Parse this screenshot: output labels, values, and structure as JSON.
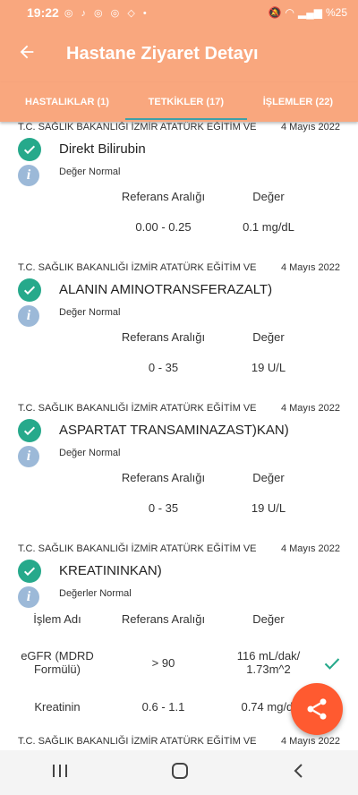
{
  "status_bar": {
    "time": "19:22",
    "battery": "%25"
  },
  "app_bar": {
    "title": "Hastane Ziyaret Detayı"
  },
  "tabs": [
    {
      "label": "HASTALIKLAR (1)"
    },
    {
      "label": "TETKİKLER (17)"
    },
    {
      "label": "İŞLEMLER (22)"
    }
  ],
  "colors": {
    "header": "#f9a77e",
    "check": "#26a98b",
    "info": "#9cb9d8",
    "fab": "#ff5a30",
    "tab_indicator": "#3fa0a8"
  },
  "labels": {
    "ref_range": "Referans Aralığı",
    "value": "Değer",
    "process_name": "İşlem Adı"
  },
  "tests": [
    {
      "hospital": "T.C. SAĞLIK BAKANLIĞI İZMİR ATATÜRK EĞİTİM VE",
      "date": "4 Mayıs 2022",
      "name": "Direkt Bilirubin",
      "status": "Değer Normal",
      "range": "0.00 - 0.25",
      "value": "0.1 mg/dL"
    },
    {
      "hospital": "T.C. SAĞLIK BAKANLIĞI İZMİR ATATÜRK EĞİTİM VE",
      "date": "4 Mayıs 2022",
      "name": "ALANIN AMINOTRANSFERAZALT)",
      "status": "Değer Normal",
      "range": "0 - 35",
      "value": "19 U/L"
    },
    {
      "hospital": "T.C. SAĞLIK BAKANLIĞI İZMİR ATATÜRK EĞİTİM VE",
      "date": "4 Mayıs 2022",
      "name": "ASPARTAT TRANSAMINAZAST)KAN)",
      "status": "Değer Normal",
      "range": "0 - 35",
      "value": "19 U/L"
    }
  ],
  "multi_test": {
    "hospital": "T.C. SAĞLIK BAKANLIĞI İZMİR ATATÜRK EĞİTİM VE",
    "date": "4 Mayıs 2022",
    "name": "KREATININKAN)",
    "status": "Değerler Normal",
    "rows": [
      {
        "process_line1": "eGFR (MDRD",
        "process_line2": "Formülü)",
        "range": "> 90",
        "value_line1": "116 mL/dak/",
        "value_line2": "1.73m^2"
      },
      {
        "process_line1": "Kreatinin",
        "process_line2": "",
        "range": "0.6 - 1.1",
        "value_line1": "0.74 mg/dL",
        "value_line2": ""
      }
    ]
  },
  "next_card": {
    "hospital": "T.C. SAĞLIK BAKANLIĞI İZMİR ATATÜRK EĞİTİM VE",
    "date": "4 Mayıs 2022"
  }
}
